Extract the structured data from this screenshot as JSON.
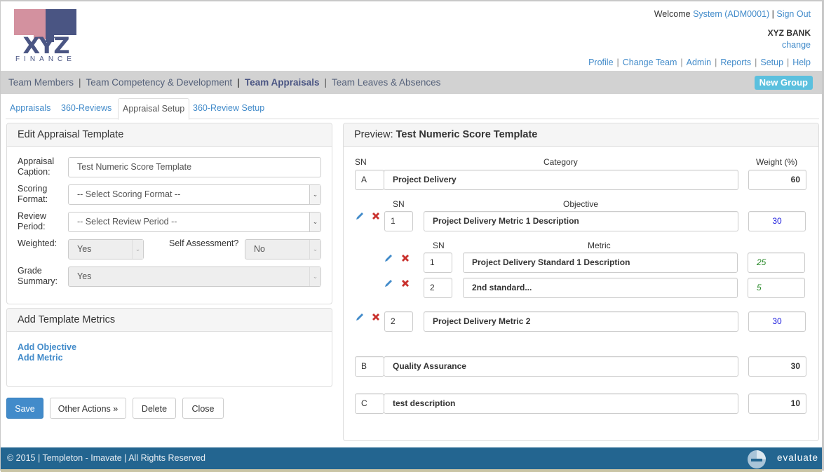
{
  "logo": {
    "brand": "XYZ",
    "sub": "FINANCE"
  },
  "header": {
    "welcome_prefix": "Welcome",
    "user": "System (ADM0001)",
    "sign_out": "Sign Out",
    "sep": "|",
    "bank": "XYZ BANK",
    "change": "change",
    "links": [
      "Profile",
      "Change Team",
      "Admin",
      "Reports",
      "Setup",
      "Help"
    ]
  },
  "mainnav": {
    "items": [
      "Team Members",
      "Team Competency & Development",
      "Team Appraisals",
      "Team Leaves & Absences"
    ],
    "active_index": 2,
    "new_group": "New Group"
  },
  "subtabs": {
    "items": [
      "Appraisals",
      "360-Reviews",
      "Appraisal Setup",
      "360-Review Setup"
    ],
    "active_index": 2
  },
  "edit_panel": {
    "title": "Edit Appraisal Template",
    "caption_label_1": "Appraisal",
    "caption_label_2": "Caption:",
    "caption_value": "Test Numeric Score Template",
    "scoring_label_1": "Scoring",
    "scoring_label_2": "Format:",
    "scoring_value": "-- Select Scoring Format --",
    "review_label_1": "Review",
    "review_label_2": "Period:",
    "review_value": "-- Select Review Period --",
    "weighted_label": "Weighted:",
    "weighted_value": "Yes",
    "self_label": "Self Assessment?",
    "self_value": "No",
    "grade_label_1": "Grade",
    "grade_label_2": "Summary:",
    "grade_value": "Yes"
  },
  "metrics_panel": {
    "title": "Add Template Metrics",
    "add_objective": "Add Objective",
    "add_metric": "Add Metric"
  },
  "buttons": {
    "save": "Save",
    "other_actions": "Other Actions »",
    "delete": "Delete",
    "close": "Close"
  },
  "preview": {
    "title_prefix": "Preview:",
    "title_name": "Test Numeric Score Template",
    "col_sn": "SN",
    "col_category": "Category",
    "col_weight": "Weight (%)",
    "col_objective": "Objective",
    "col_metric": "Metric",
    "categories": [
      {
        "sn": "A",
        "name": "Project Delivery",
        "weight": "60"
      },
      {
        "sn": "B",
        "name": "Quality Assurance",
        "weight": "30"
      },
      {
        "sn": "C",
        "name": "test description",
        "weight": "10"
      }
    ],
    "objectives": [
      {
        "sn": "1",
        "name": "Project Delivery Metric 1 Description",
        "weight": "30"
      },
      {
        "sn": "2",
        "name": "Project Delivery Metric 2",
        "weight": "30"
      }
    ],
    "metrics": [
      {
        "sn": "1",
        "name": "Project Delivery Standard 1 Description",
        "weight": "25"
      },
      {
        "sn": "2",
        "name": "2nd standard...",
        "weight": "5"
      }
    ]
  },
  "footer": {
    "copyright": "© 2015 | Templeton - Imavate | All Rights Reserved",
    "brand": "evaluate"
  },
  "colors": {
    "link": "#428bca",
    "nav_bg": "#d2d2d2",
    "new_group": "#5bc0de",
    "primary": "#428bca",
    "footer": "#236590",
    "delete_icon": "#c9302c",
    "objective_weight": "#1a1add",
    "metric_weight": "#2a8a2a"
  }
}
